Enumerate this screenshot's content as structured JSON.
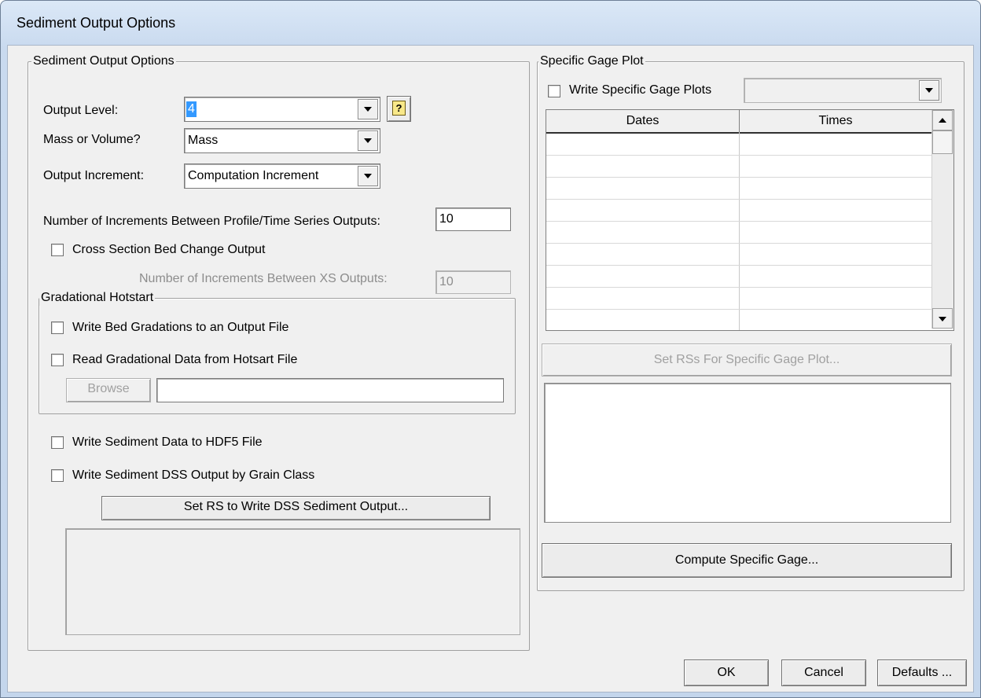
{
  "window": {
    "title": "Sediment Output Options"
  },
  "left_group": {
    "title": "Sediment Output Options",
    "output_level": {
      "label": "Output Level:",
      "value": "4"
    },
    "mass_volume": {
      "label": "Mass or Volume?",
      "value": "Mass"
    },
    "output_increment": {
      "label": "Output Increment:",
      "value": "Computation Increment"
    },
    "num_increments": {
      "label": "Number of Increments Between Profile/Time Series Outputs:",
      "value": "10"
    },
    "xs_bed_change": {
      "label": "Cross Section Bed Change Output"
    },
    "xs_increments": {
      "label": "Number of Increments Between XS Outputs:",
      "value": "10"
    },
    "hotstart": {
      "title": "Gradational Hotstart",
      "write_label": "Write Bed Gradations to an Output File",
      "read_label": "Read Gradational Data from Hotsart File",
      "browse_label": "Browse",
      "path_value": ""
    },
    "write_hdf5_label": "Write Sediment Data to HDF5 File",
    "write_dss_label": "Write Sediment DSS Output by Grain Class",
    "set_rs_dss_label": "Set RS to Write DSS Sediment Output..."
  },
  "right_group": {
    "title": "Specific Gage Plot",
    "write_plots_label": "Write Specific Gage Plots",
    "plots_combo_value": "",
    "table": {
      "columns": [
        "Dates",
        "Times"
      ],
      "rows": [
        [
          "",
          ""
        ],
        [
          "",
          ""
        ],
        [
          "",
          ""
        ],
        [
          "",
          ""
        ],
        [
          "",
          ""
        ],
        [
          "",
          ""
        ],
        [
          "",
          ""
        ],
        [
          "",
          ""
        ],
        [
          "",
          ""
        ]
      ]
    },
    "set_rs_label": "Set RSs For Specific Gage Plot...",
    "compute_label": "Compute Specific Gage..."
  },
  "footer": {
    "ok_label": "OK",
    "cancel_label": "Cancel",
    "defaults_label": "Defaults ..."
  }
}
